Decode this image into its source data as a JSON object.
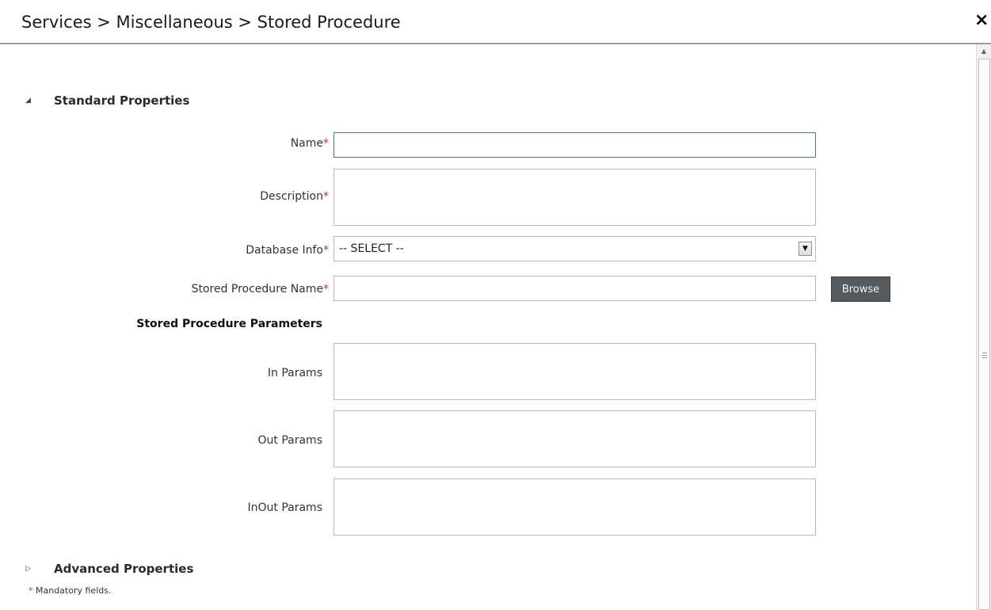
{
  "breadcrumb": "Services > Miscellaneous > Stored Procedure",
  "close_label": "×",
  "sections": {
    "standard": {
      "toggle_glyph": "◢",
      "title": "Standard Properties"
    },
    "advanced": {
      "toggle_glyph": "▷",
      "title": "Advanced Properties"
    }
  },
  "fields": {
    "name": {
      "label": "Name",
      "required": "*",
      "value": ""
    },
    "description": {
      "label": "Description",
      "required": "*",
      "value": ""
    },
    "database_info": {
      "label": "Database Info",
      "required": "*",
      "selected": "-- SELECT --"
    },
    "sp_name": {
      "label": "Stored Procedure Name",
      "required": "*",
      "value": ""
    },
    "browse_label": "Browse"
  },
  "params": {
    "heading": "Stored Procedure Parameters",
    "in": {
      "label": "In Params",
      "value": ""
    },
    "out": {
      "label": "Out Params",
      "value": ""
    },
    "inout": {
      "label": "InOut Params",
      "value": ""
    }
  },
  "footer": {
    "star": "*",
    "note": "Mandatory fields."
  },
  "scrollbar": {
    "up_arrow": "▲"
  }
}
